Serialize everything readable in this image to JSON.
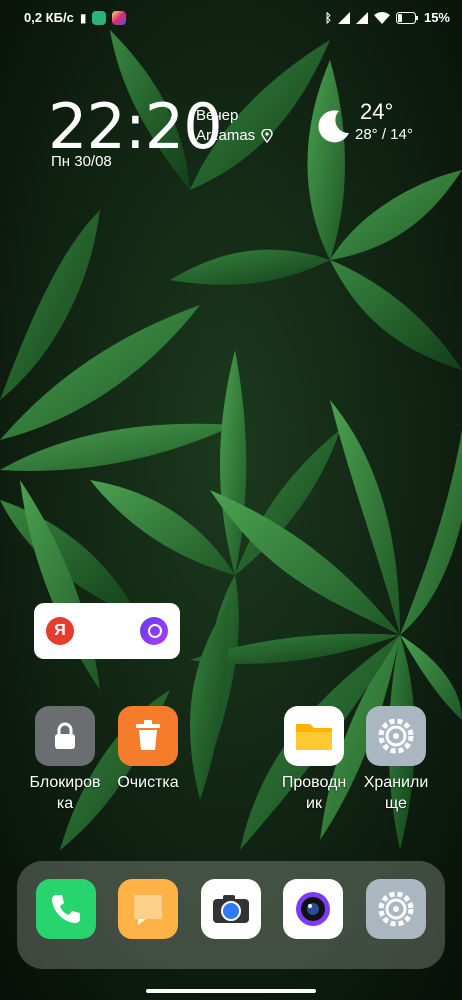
{
  "status_bar": {
    "speed": "0,2 КБ/с",
    "battery": "15%",
    "icons": [
      "vibrate-icon",
      "shield-app-icon",
      "instagram-app-icon",
      "bluetooth-icon",
      "signal-icon",
      "signal-icon",
      "wifi-icon",
      "battery-icon"
    ]
  },
  "clock_widget": {
    "time": "22:20",
    "period": "Вечер",
    "city": "Arzamas",
    "date": "Пн 30/08"
  },
  "weather": {
    "icon": "moon-icon",
    "temp": "24°",
    "range": "28° / 14°"
  },
  "search_widget": {
    "yandex_letter": "Я",
    "colors": {
      "yandex": "#e43c2e",
      "alice": "#7b3cf2"
    }
  },
  "apps": [
    {
      "id": "lock",
      "label": "Блокировка",
      "icon": "lock-icon",
      "color": "#6b6e70"
    },
    {
      "id": "cleaner",
      "label": "Очистка",
      "icon": "trash-icon",
      "color": "#f57c2a"
    },
    {
      "id": "files",
      "label": "Проводник",
      "icon": "folder-icon",
      "color": "#ffffff"
    },
    {
      "id": "storage",
      "label": "Хранилище",
      "icon": "gear-icon",
      "color": "#aab6c0"
    }
  ],
  "dock": [
    {
      "id": "phone",
      "icon": "phone-icon",
      "color": "#27d46e"
    },
    {
      "id": "messages",
      "icon": "message-icon",
      "color": "#ffb347"
    },
    {
      "id": "camera",
      "icon": "camera-icon",
      "color": "#ffffff"
    },
    {
      "id": "gallery",
      "icon": "lens-icon",
      "color": "#ffffff"
    },
    {
      "id": "settings",
      "icon": "gear-icon",
      "color": "#aab6c0"
    }
  ]
}
